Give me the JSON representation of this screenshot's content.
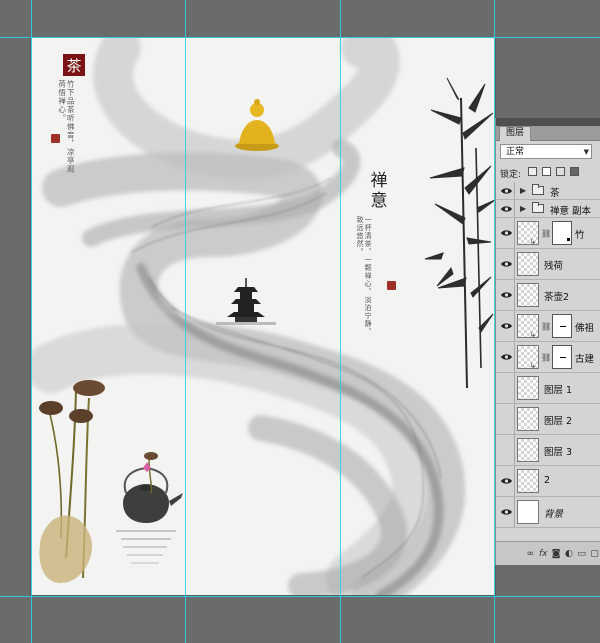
{
  "document": {
    "seal_text": "茶",
    "title_text": "禅意",
    "poem_left": "竹下品茶听佛音，凉亭观荷悟禅心。",
    "poem_right": "一杯清茶，一颗禅心，淡泊宁静，致远悠然。"
  },
  "layers_panel": {
    "tab_label": "图层",
    "blend_mode": "正常",
    "lock_label": "锁定:",
    "layers": [
      {
        "name": "茶",
        "type": "group",
        "visible": true
      },
      {
        "name": "禅意 副本",
        "type": "group",
        "visible": true
      },
      {
        "name": "竹",
        "type": "masked",
        "visible": true
      },
      {
        "name": "残荷",
        "type": "normal",
        "visible": true
      },
      {
        "name": "茶壶2",
        "type": "normal",
        "visible": true
      },
      {
        "name": "佛祖",
        "type": "masked",
        "visible": true
      },
      {
        "name": "古建",
        "type": "masked",
        "visible": true
      },
      {
        "name": "图层 1",
        "type": "normal",
        "visible": false
      },
      {
        "name": "图层 2",
        "type": "normal",
        "visible": false
      },
      {
        "name": "图层 3",
        "type": "normal",
        "visible": false
      },
      {
        "name": "2",
        "type": "normal",
        "visible": true
      },
      {
        "name": "背景",
        "type": "background",
        "visible": true
      }
    ],
    "bottom_icons": [
      "link-icon",
      "fx-icon",
      "mask-icon",
      "adjustment-icon",
      "folder-icon",
      "new-layer-icon",
      "trash-icon"
    ]
  }
}
